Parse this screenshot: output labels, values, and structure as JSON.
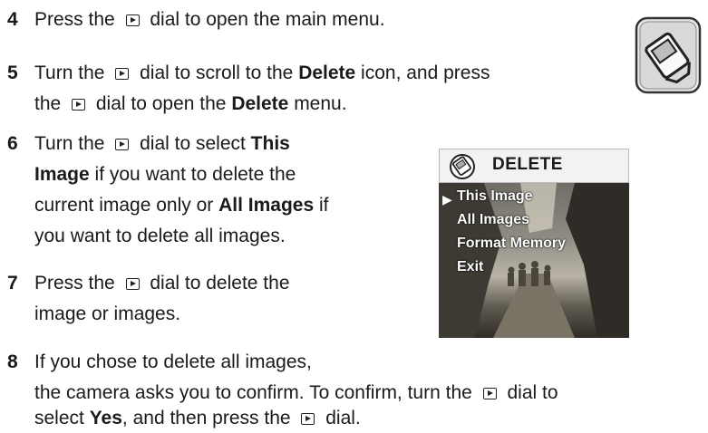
{
  "steps": [
    {
      "num": "4",
      "parts": [
        "Press the ",
        "{dial}",
        " dial to open the main menu."
      ]
    },
    {
      "num": "5",
      "line1": [
        "Turn the ",
        "{dial}",
        " dial to scroll to the ",
        "**Delete",
        " icon, and press"
      ],
      "line2": [
        "the ",
        "{dial}",
        " dial to open the ",
        "**Delete",
        " menu."
      ]
    },
    {
      "num": "6",
      "lines": [
        [
          "Turn the ",
          "{dial}",
          " dial to select ",
          "**This"
        ],
        [
          "**Image",
          " if you want to delete the"
        ],
        [
          "current image only or ",
          "**All Images",
          " if"
        ],
        [
          "you want to delete all images."
        ]
      ]
    },
    {
      "num": "7",
      "lines": [
        [
          "Press the ",
          "{dial}",
          " dial to delete the"
        ],
        [
          "image or images."
        ]
      ]
    },
    {
      "num": "8",
      "lines": [
        [
          "If you chose to delete all images,"
        ],
        [
          "the camera asks you to confirm. To confirm, turn the ",
          "{dial}",
          " dial to"
        ],
        [
          "select ",
          "**Yes",
          ", and then press the ",
          "{dial}",
          " dial."
        ]
      ]
    }
  ],
  "screen": {
    "title": "DELETE",
    "menu": [
      "This Image",
      "All Images",
      "Format Memory",
      "Exit"
    ],
    "selected_index": 0
  },
  "icons": {
    "dial": "play-dial-icon",
    "badge": "delete-icon"
  }
}
